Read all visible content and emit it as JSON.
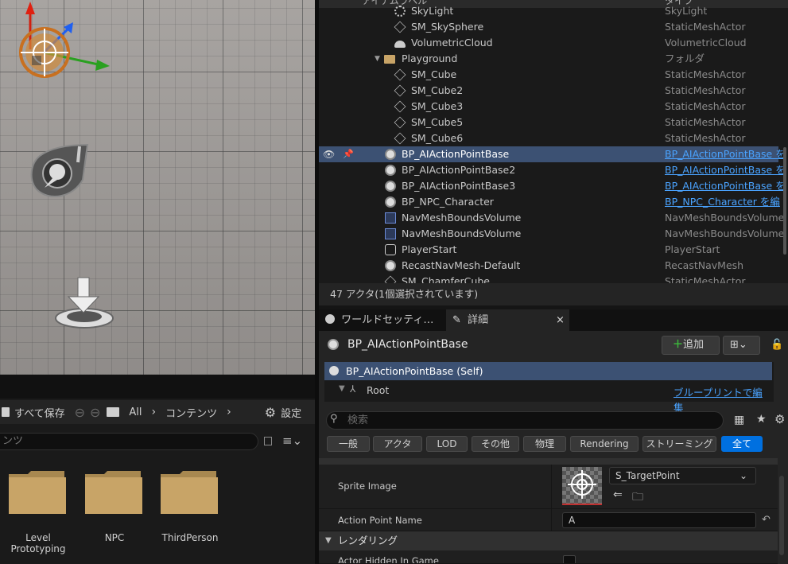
{
  "outliner": {
    "header_label": "アイテムラベル",
    "type_header": "タイプ",
    "rows": [
      {
        "name": "SkyLight",
        "type": "SkyLight",
        "icon": "light-icon",
        "indent": 1,
        "link": false,
        "selected": false
      },
      {
        "name": "SM_SkySphere",
        "type": "StaticMeshActor",
        "icon": "cube-icon",
        "indent": 1,
        "link": false,
        "selected": false
      },
      {
        "name": "VolumetricCloud",
        "type": "VolumetricCloud",
        "icon": "cloud-icon",
        "indent": 1,
        "link": false,
        "selected": false
      },
      {
        "name": "Playground",
        "type": "フォルダ",
        "icon": "folder-icon",
        "indent": 0,
        "link": false,
        "selected": false,
        "folder": true
      },
      {
        "name": "SM_Cube",
        "type": "StaticMeshActor",
        "icon": "cube-icon",
        "indent": 1,
        "link": false,
        "selected": false
      },
      {
        "name": "SM_Cube2",
        "type": "StaticMeshActor",
        "icon": "cube-icon",
        "indent": 1,
        "link": false,
        "selected": false
      },
      {
        "name": "SM_Cube3",
        "type": "StaticMeshActor",
        "icon": "cube-icon",
        "indent": 1,
        "link": false,
        "selected": false
      },
      {
        "name": "SM_Cube5",
        "type": "StaticMeshActor",
        "icon": "cube-icon",
        "indent": 1,
        "link": false,
        "selected": false
      },
      {
        "name": "SM_Cube6",
        "type": "StaticMeshActor",
        "icon": "cube-icon",
        "indent": 1,
        "link": false,
        "selected": false
      },
      {
        "name": "BP_AIActionPointBase",
        "type": "BP_AIActionPointBase を",
        "icon": "actor-icon",
        "indent": 2,
        "link": true,
        "selected": true
      },
      {
        "name": "BP_AIActionPointBase2",
        "type": "BP_AIActionPointBase を",
        "icon": "actor-icon",
        "indent": 2,
        "link": true,
        "selected": false
      },
      {
        "name": "BP_AIActionPointBase3",
        "type": "BP_AIActionPointBase を",
        "icon": "actor-icon",
        "indent": 2,
        "link": true,
        "selected": false
      },
      {
        "name": "BP_NPC_Character",
        "type": "BP_NPC_Character を編",
        "icon": "character-icon",
        "indent": 2,
        "link": true,
        "selected": false
      },
      {
        "name": "NavMeshBoundsVolume",
        "type": "NavMeshBoundsVolume",
        "icon": "volume-icon",
        "indent": 2,
        "link": false,
        "selected": false
      },
      {
        "name": "NavMeshBoundsVolume",
        "type": "NavMeshBoundsVolume",
        "icon": "volume-icon",
        "indent": 2,
        "link": false,
        "selected": false
      },
      {
        "name": "PlayerStart",
        "type": "PlayerStart",
        "icon": "player-start-icon",
        "indent": 2,
        "link": false,
        "selected": false
      },
      {
        "name": "RecastNavMesh-Default",
        "type": "RecastNavMesh",
        "icon": "actor-icon",
        "indent": 2,
        "link": false,
        "selected": false
      },
      {
        "name": "SM_ChamferCube",
        "type": "StaticMeshActor",
        "icon": "cube-icon",
        "indent": 2,
        "link": false,
        "selected": false
      }
    ],
    "status": "47 アクタ(1個選択されています)"
  },
  "tabs": {
    "world_settings": "ワールドセッティ…",
    "details": "詳細"
  },
  "details": {
    "actor_name": "BP_AIActionPointBase",
    "add_label": "追加",
    "component_self": "BP_AIActionPointBase (Self)",
    "component_root": "Root",
    "blueprint_link": "ブループリントで編集",
    "search_placeholder": "検索",
    "filters": [
      "一般",
      "アクタ",
      "LOD",
      "その他",
      "物理",
      "Rendering",
      "ストリーミング",
      "全て"
    ],
    "sprite_label": "Sprite Image",
    "sprite_value": "S_TargetPoint",
    "action_point_label": "Action Point Name",
    "action_point_value": "A",
    "section_rendering": "レンダリング",
    "actor_hidden_label": "Actor Hidden In Game"
  },
  "content_browser": {
    "save_all": "すべて保存",
    "path_all": "All",
    "path_content": "コンテンツ",
    "settings": "設定",
    "search_placeholder": "ンツ",
    "folders": [
      {
        "label": "Level\nPrototyping"
      },
      {
        "label": "NPC"
      },
      {
        "label": "ThirdPerson"
      }
    ]
  },
  "colors": {
    "accent": "#0070e0",
    "selection": "#3c5173",
    "link": "#4aa3ff",
    "folder": "#c8a467"
  }
}
